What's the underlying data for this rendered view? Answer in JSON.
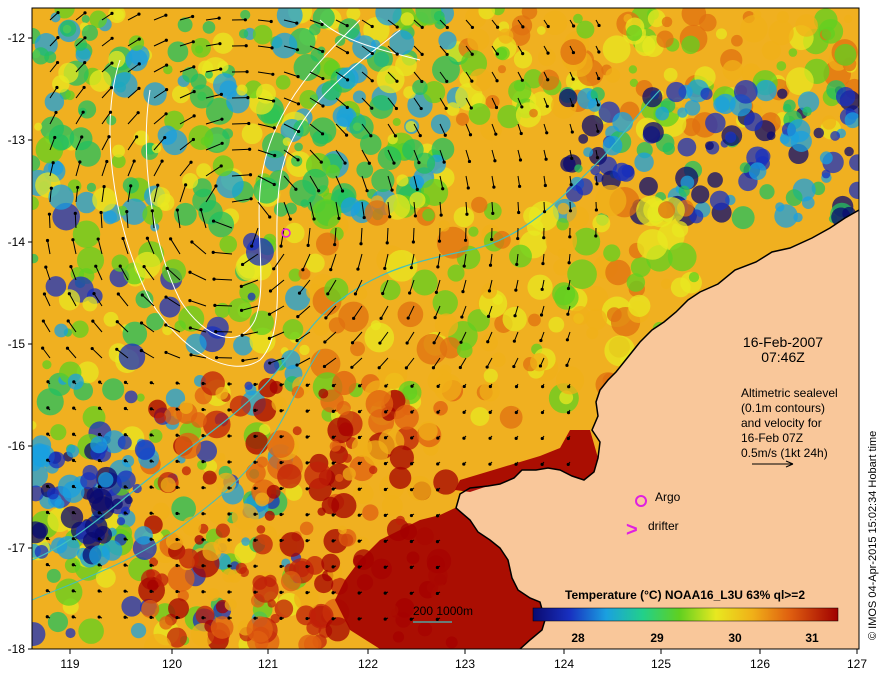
{
  "map": {
    "date": "16-Feb-2007",
    "time": "07:46Z",
    "altimetry_lines": [
      "Altimetric sealevel",
      "(0.1m contours)",
      "and velocity for",
      "16-Feb 07Z",
      "0.5m/s (1kt 24h)"
    ],
    "legend_argo": "Argo",
    "legend_drifter": "drifter",
    "legend_drifter_symbol": ">",
    "isobath_label": "200  1000m",
    "colorbar_title": "Temperature (°C) NOAA16_L3U 63% ql>=2",
    "colorbar_ticks": [
      "28",
      "29",
      "30",
      "31"
    ],
    "credit": "© IMOS 04-Apr-2015 15:02:34 Hobart time",
    "y_ticks": [
      "-12",
      "-13",
      "-14",
      "-15",
      "-16",
      "-17",
      "-18"
    ],
    "x_ticks": [
      "119",
      "120",
      "121",
      "122",
      "123",
      "124",
      "125",
      "126",
      "127"
    ],
    "colors": {
      "land": "#f9c79a",
      "argo": "#e020e0",
      "isobath": "#40c0c0",
      "contour": "#ffffff"
    }
  }
}
